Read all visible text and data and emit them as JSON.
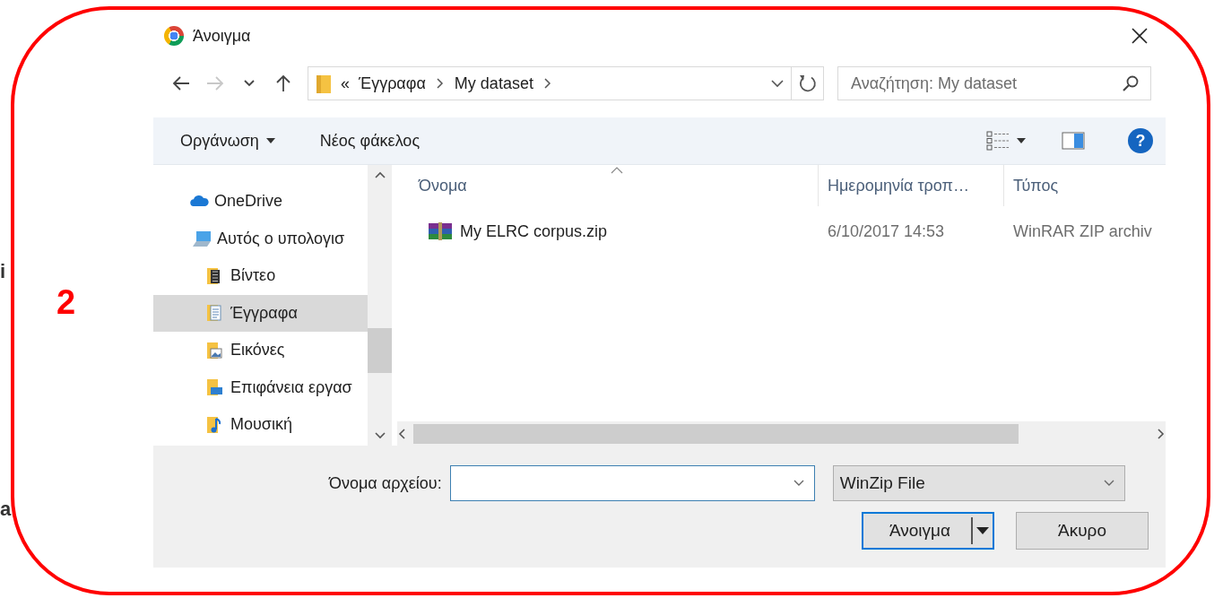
{
  "annotation": {
    "label": "2"
  },
  "background_fragments": [
    "i",
    "a"
  ],
  "window": {
    "title": "Άνοιγμα"
  },
  "nav_buttons": [
    {
      "kind": "back",
      "disabled": false
    },
    {
      "kind": "forward",
      "disabled": true
    },
    {
      "kind": "recent",
      "disabled": false
    },
    {
      "kind": "up",
      "disabled": false
    }
  ],
  "address_bar": {
    "overflow": "«",
    "crumbs": [
      "Έγγραφα",
      "My dataset"
    ]
  },
  "search": {
    "placeholder": "Αναζήτηση: My dataset"
  },
  "toolbar": {
    "organize": "Οργάνωση",
    "new_folder": "Νέος φάκελος",
    "help": "?"
  },
  "sidebar": {
    "items": [
      {
        "label": "OneDrive",
        "kind": "cloud",
        "selected": false
      },
      {
        "label": "Αυτός ο υπολογισ",
        "kind": "computer",
        "selected": false,
        "children": [
          {
            "label": "Βίντεο",
            "kind": "video",
            "selected": false
          },
          {
            "label": "Έγγραφα",
            "kind": "documents",
            "selected": true
          },
          {
            "label": "Εικόνες",
            "kind": "pictures",
            "selected": false
          },
          {
            "label": "Επιφάνεια εργασ",
            "kind": "desktop",
            "selected": false
          },
          {
            "label": "Μουσική",
            "kind": "music",
            "selected": false
          }
        ]
      }
    ]
  },
  "table": {
    "columns": [
      "Όνομα",
      "Ημερομηνία τροπ…",
      "Τύπος"
    ],
    "rows": [
      {
        "name": "My ELRC corpus.zip",
        "date": "6/10/2017 14:53",
        "type": "WinRAR ZIP archiv",
        "selected": false
      }
    ]
  },
  "footer": {
    "file_name_label": "Όνομα αρχείου:",
    "file_type": "WinZip File",
    "buttons": [
      {
        "label": "Άνοιγμα",
        "kind": "split",
        "default": true
      },
      {
        "label": "Άκυρο",
        "kind": "plain",
        "default": false
      }
    ]
  }
}
